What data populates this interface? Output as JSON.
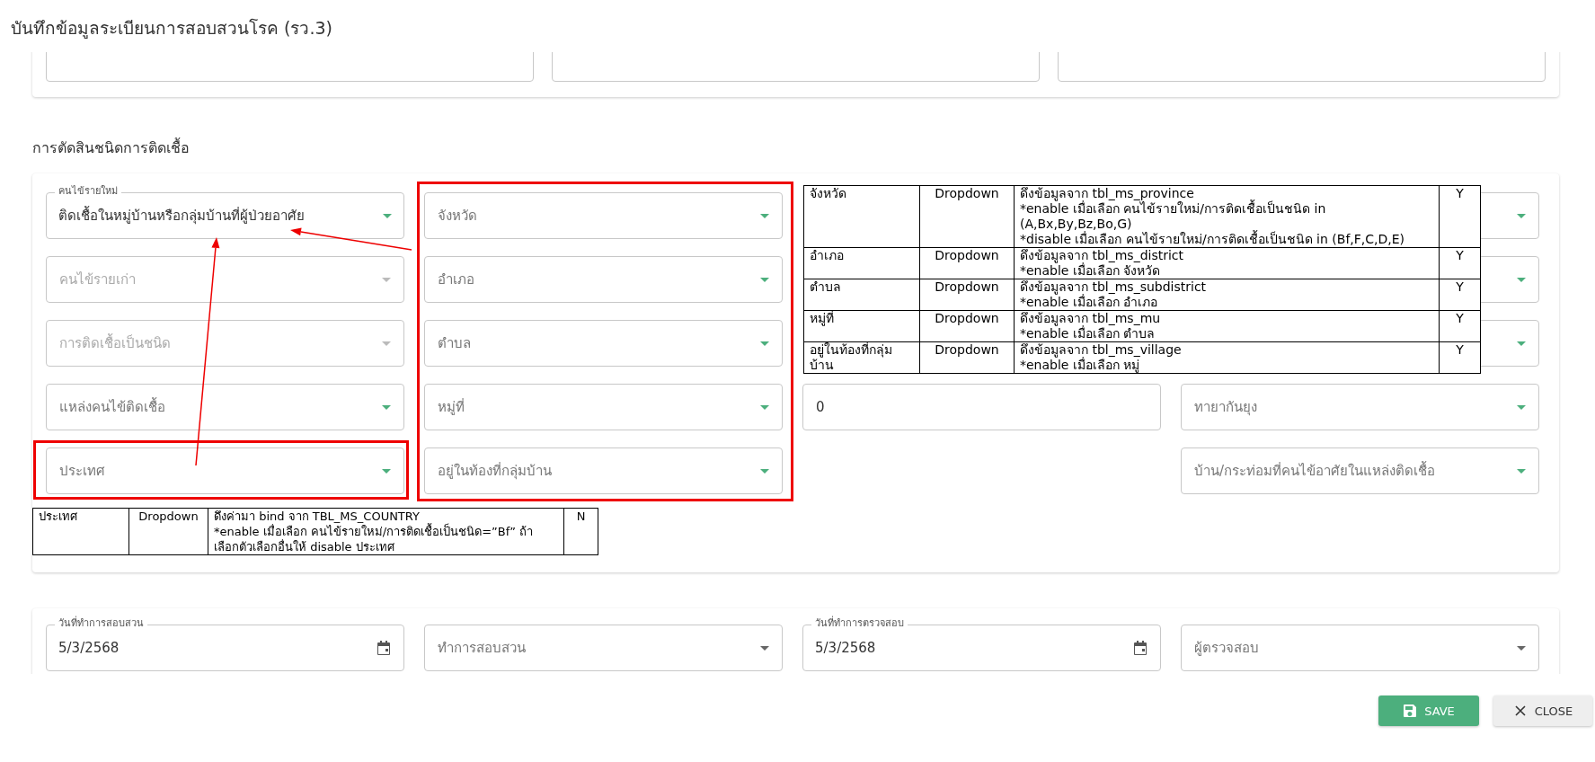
{
  "dialog": {
    "title": "บันทึกข้อมูลระเบียนการสอบสวนโรค (รว.3)"
  },
  "section": {
    "title": "การตัดสินชนิดการติดเชื้อ",
    "columns": [
      [
        {
          "kind": "select",
          "label": "คนไข้รายใหม่",
          "value": "ติดเชื้อในหมู่บ้านหรือกลุ่มบ้านที่ผู้ป่วยอาศัย",
          "disabled": false
        },
        {
          "kind": "select",
          "placeholder": "คนไข้รายเก่า",
          "disabled": true
        },
        {
          "kind": "select",
          "placeholder": "การติดเชื้อเป็นชนิด",
          "disabled": true
        },
        {
          "kind": "select",
          "placeholder": "แหล่งคนไข้ติดเชื้อ",
          "disabled": false
        },
        {
          "kind": "select",
          "placeholder": "ประเทศ",
          "disabled": false
        }
      ],
      [
        {
          "kind": "select",
          "placeholder": "จังหวัด",
          "disabled": false
        },
        {
          "kind": "select",
          "placeholder": "อำเภอ",
          "disabled": false
        },
        {
          "kind": "select",
          "placeholder": "ตำบล",
          "disabled": false
        },
        {
          "kind": "select",
          "placeholder": "หมู่ที่",
          "disabled": false
        },
        {
          "kind": "select",
          "placeholder": "อยู่ในท้องที่กลุ่มบ้าน",
          "disabled": false
        }
      ],
      [
        {
          "kind": "input",
          "value": "0",
          "disabled": false
        }
      ],
      [
        {
          "kind": "select",
          "disabled": false
        },
        {
          "kind": "select",
          "disabled": false
        },
        {
          "kind": "select",
          "disabled": false
        },
        {
          "kind": "select",
          "placeholder": "ทายากันยุง",
          "disabled": false
        },
        {
          "kind": "select",
          "placeholder": "บ้าน/กระท่อมที่คนไข้อาศัยในแหล่งติดเชื้อ",
          "disabled": false
        }
      ]
    ]
  },
  "spec_table": {
    "rows": [
      {
        "field": "จังหวัด",
        "type": "Dropdown",
        "description": [
          "ดึงข้อมูลจาก tbl_ms_province",
          "*enable เมื่อเลือก คนไข้รายใหม่/การติดเชื้อเป็นชนิด in (A,Bx,By,Bz,Bo,G)",
          "*disable เมื่อเลือก คนไข้รายใหม่/การติดเชื้อเป็นชนิด in (Bf,F,C,D,E)"
        ],
        "required": "Y"
      },
      {
        "field": "อำเภอ",
        "type": "Dropdown",
        "description": [
          "ดึงข้อมูลจาก tbl_ms_district",
          "*enable เมื่อเลือก จังหวัด"
        ],
        "required": "Y"
      },
      {
        "field": "ตำบล",
        "type": "Dropdown",
        "description": [
          "ดึงข้อมูลจาก tbl_ms_subdistrict",
          "*enable เมื่อเลือก อำเภอ"
        ],
        "required": "Y"
      },
      {
        "field": "หมู่ที่",
        "type": "Dropdown",
        "description": [
          "ดึงข้อมูลจาก tbl_ms_mu",
          "*enable เมื่อเลือก ตำบล"
        ],
        "required": "Y"
      },
      {
        "field": "อยู่ในท้องที่กลุ่มบ้าน",
        "type": "Dropdown",
        "description": [
          "ดึงข้อมูลจาก tbl_ms_village",
          "*enable เมื่อเลือก หมู่"
        ],
        "required": "Y"
      }
    ]
  },
  "country_spec_table": {
    "rows": [
      {
        "field": "ประเทศ",
        "type": "Dropdown",
        "description": [
          "ดึงค่ามา bind จาก TBL_MS_COUNTRY",
          "*enable เมื่อเลือก คนไข้รายใหม่/การติดเชื้อเป็นชนิด=”Bf” ถ้าเลือกตัวเลือกอื่นให้ disable ประเทศ"
        ],
        "required": "N"
      }
    ]
  },
  "inspection": {
    "fields": [
      {
        "kind": "date",
        "label": "วันที่ทำการสอบสวน",
        "value": "5/3/2568",
        "disabled": false
      },
      {
        "kind": "select",
        "placeholder": "ทำการสอบสวน",
        "disabled": false
      },
      {
        "kind": "date",
        "label": "วันที่ทำการตรวจสอบ",
        "value": "5/3/2568",
        "disabled": false
      },
      {
        "kind": "select",
        "placeholder": "ผู้ตรวจสอบ",
        "disabled": false
      }
    ]
  },
  "buttons": [
    {
      "kind": "save",
      "label": "SAVE"
    },
    {
      "kind": "close",
      "label": "CLOSE"
    }
  ]
}
